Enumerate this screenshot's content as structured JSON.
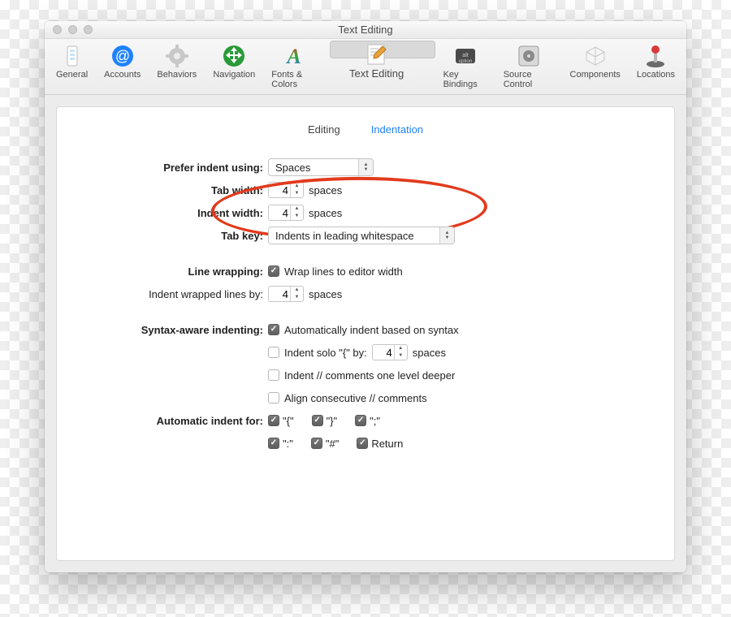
{
  "window_title": "Text Editing",
  "toolbar": [
    {
      "label": "General"
    },
    {
      "label": "Accounts"
    },
    {
      "label": "Behaviors"
    },
    {
      "label": "Navigation"
    },
    {
      "label": "Fonts & Colors"
    },
    {
      "label": "Text Editing"
    },
    {
      "label": "Key Bindings"
    },
    {
      "label": "Source Control"
    },
    {
      "label": "Components"
    },
    {
      "label": "Locations"
    }
  ],
  "subtabs": {
    "editing": "Editing",
    "indentation": "Indentation"
  },
  "labels": {
    "prefer": "Prefer indent using:",
    "tabw": "Tab width:",
    "indw": "Indent width:",
    "tabkey": "Tab key:",
    "linewrap": "Line wrapping:",
    "indentwrapped": "Indent wrapped lines by:",
    "syntax": "Syntax-aware indenting:",
    "autofor": "Automatic indent for:"
  },
  "values": {
    "prefer": "Spaces",
    "tabw": "4",
    "indw": "4",
    "tabkey": "Indents in leading whitespace",
    "spaces": "spaces",
    "wrap": "Wrap lines to editor width",
    "wrapby": "4",
    "autosyntax": "Automatically indent based on syntax",
    "soloA": "Indent solo \"{\" by:",
    "solonum": "4",
    "comments": "Indent // comments one level deeper",
    "align": "Align consecutive // comments",
    "ai1": "\"{\"",
    "ai2": "\"}\"",
    "ai3": "\";\"",
    "ai4": "\":\"",
    "ai5": "\"#\"",
    "ai6": "Return"
  }
}
